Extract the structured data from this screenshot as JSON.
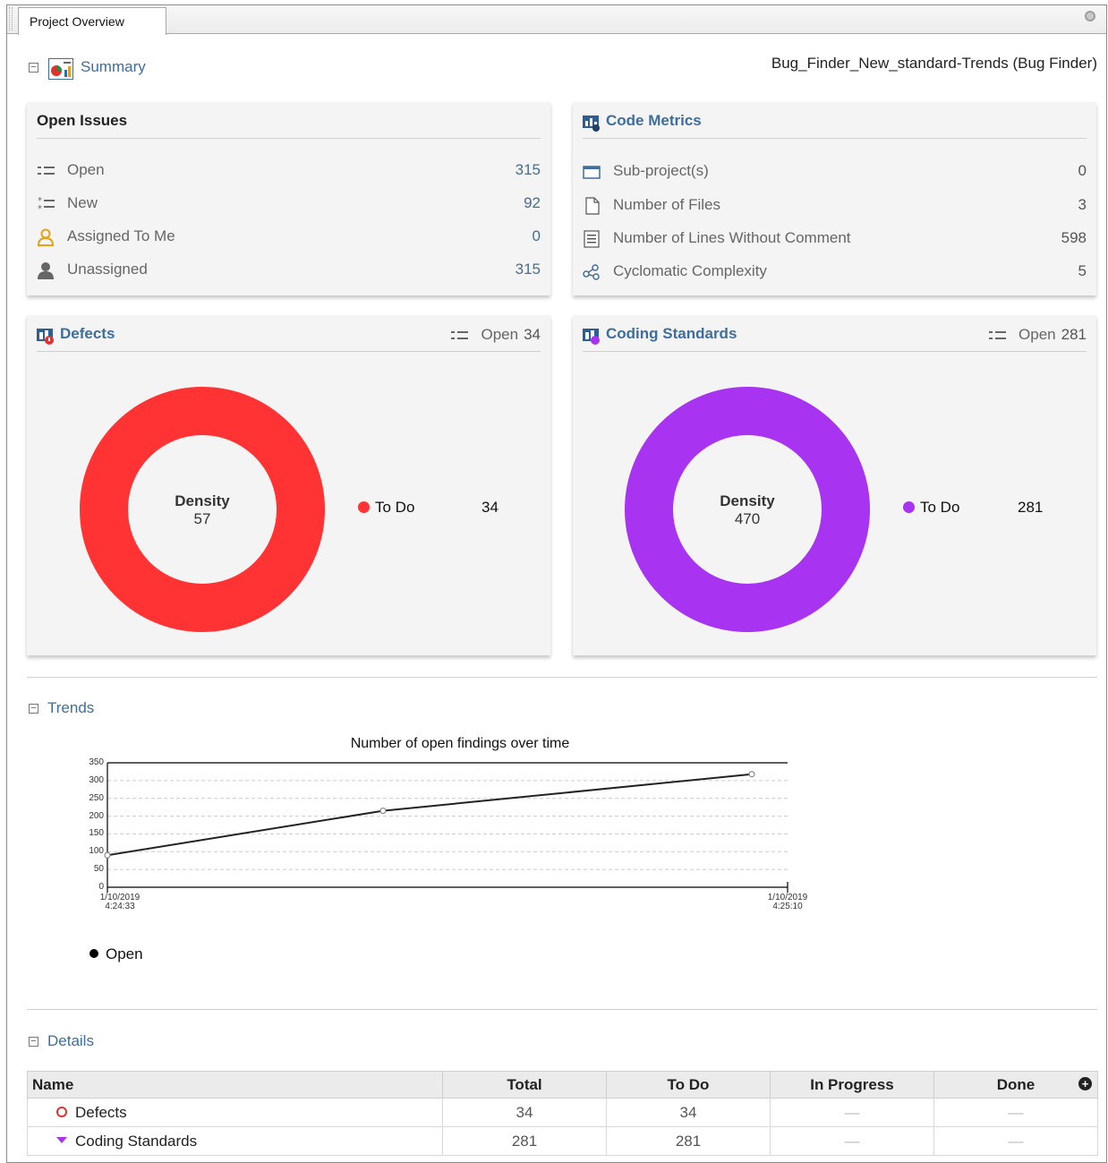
{
  "tab": {
    "title": "Project Overview"
  },
  "summary": {
    "label": "Summary",
    "project": "Bug_Finder_New_standard-Trends (Bug Finder)"
  },
  "open_issues": {
    "title": "Open Issues",
    "rows": [
      {
        "label": "Open",
        "value": "315",
        "icon": "list-icon"
      },
      {
        "label": "New",
        "value": "92",
        "icon": "new-list-icon"
      },
      {
        "label": "Assigned To Me",
        "value": "0",
        "icon": "user-outline-icon"
      },
      {
        "label": "Unassigned",
        "value": "315",
        "icon": "user-solid-icon"
      }
    ]
  },
  "code_metrics": {
    "title": "Code Metrics",
    "rows": [
      {
        "label": "Sub-project(s)",
        "value": "0",
        "icon": "folder-icon"
      },
      {
        "label": "Number of Files",
        "value": "3",
        "icon": "file-icon"
      },
      {
        "label": "Number of Lines Without Comment",
        "value": "598",
        "icon": "lines-icon"
      },
      {
        "label": "Cyclomatic Complexity",
        "value": "5",
        "icon": "graph-icon"
      }
    ]
  },
  "defects": {
    "title": "Defects",
    "open_label": "Open",
    "open_value": "34",
    "density_label": "Density",
    "density_value": "57",
    "legend_label": "To Do",
    "legend_value": "34",
    "color": "#ff3333"
  },
  "coding_standards": {
    "title": "Coding Standards",
    "open_label": "Open",
    "open_value": "281",
    "density_label": "Density",
    "density_value": "470",
    "legend_label": "To Do",
    "legend_value": "281",
    "color": "#a833f0"
  },
  "trends": {
    "label": "Trends",
    "chart_data": {
      "type": "line",
      "title": "Number of open findings over time",
      "x": [
        "1/10/2019 4:24:33",
        "",
        "1/10/2019 4:25:10"
      ],
      "series": [
        {
          "name": "Open",
          "values": [
            90,
            215,
            318
          ]
        }
      ],
      "ylim": [
        0,
        350
      ],
      "yticks": [
        0,
        50,
        100,
        150,
        200,
        250,
        300,
        350
      ],
      "x_tick_labels": [
        {
          "line1": "1/10/2019",
          "line2": "4:24:33"
        },
        {
          "line1": "1/10/2019",
          "line2": "4:25:10"
        }
      ],
      "legend": "bottom-left",
      "grid": true
    }
  },
  "details": {
    "label": "Details",
    "columns": [
      "Name",
      "Total",
      "To Do",
      "In Progress",
      "Done"
    ],
    "rows": [
      {
        "name": "Defects",
        "total": "34",
        "todo": "34",
        "inprogress": "—",
        "done": "—"
      },
      {
        "name": "Coding Standards",
        "total": "281",
        "todo": "281",
        "inprogress": "—",
        "done": "—"
      }
    ]
  }
}
